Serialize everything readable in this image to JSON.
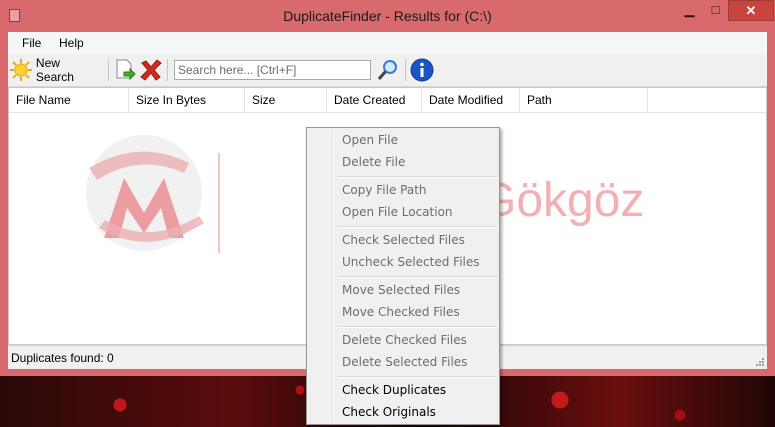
{
  "window": {
    "title": "DuplicateFinder - Results for (C:\\)",
    "minimize_glyph": "▁",
    "maximize_glyph": "□",
    "close_glyph": "✕"
  },
  "menu": {
    "items": [
      "File",
      "Help"
    ]
  },
  "toolbar": {
    "new_search_label": "New Search",
    "search_placeholder": "Search here... [Ctrl+F]",
    "icons": [
      "sun-icon",
      "export-icon",
      "delete-x-icon",
      "magnifier-icon",
      "info-icon"
    ]
  },
  "columns": [
    "File Name",
    "Size In Bytes",
    "Size",
    "Date Created",
    "Date Modified",
    "Path"
  ],
  "watermark": {
    "text": "Gökgöz",
    "colors": {
      "mark": "#e8585e",
      "text": "#f2b0b3"
    }
  },
  "status": {
    "text": "Duplicates found: 0"
  },
  "context_menu": {
    "groups": [
      {
        "items": [
          {
            "label": "Open File",
            "enabled": false
          },
          {
            "label": "Delete File",
            "enabled": false
          }
        ]
      },
      {
        "items": [
          {
            "label": "Copy File Path",
            "enabled": false
          },
          {
            "label": "Open File Location",
            "enabled": false
          }
        ]
      },
      {
        "items": [
          {
            "label": "Check Selected Files",
            "enabled": false
          },
          {
            "label": "Uncheck Selected Files",
            "enabled": false
          }
        ]
      },
      {
        "items": [
          {
            "label": "Move Selected Files",
            "enabled": false
          },
          {
            "label": "Move Checked Files",
            "enabled": false
          }
        ]
      },
      {
        "items": [
          {
            "label": "Delete Checked Files",
            "enabled": false
          },
          {
            "label": "Delete Selected Files",
            "enabled": false
          }
        ]
      },
      {
        "items": [
          {
            "label": "Check Duplicates",
            "enabled": true
          },
          {
            "label": "Check Originals",
            "enabled": true
          }
        ]
      }
    ]
  },
  "colors": {
    "window_frame": "#d8696c",
    "close_button": "#c7453c",
    "info_blue": "#1a55c8"
  }
}
